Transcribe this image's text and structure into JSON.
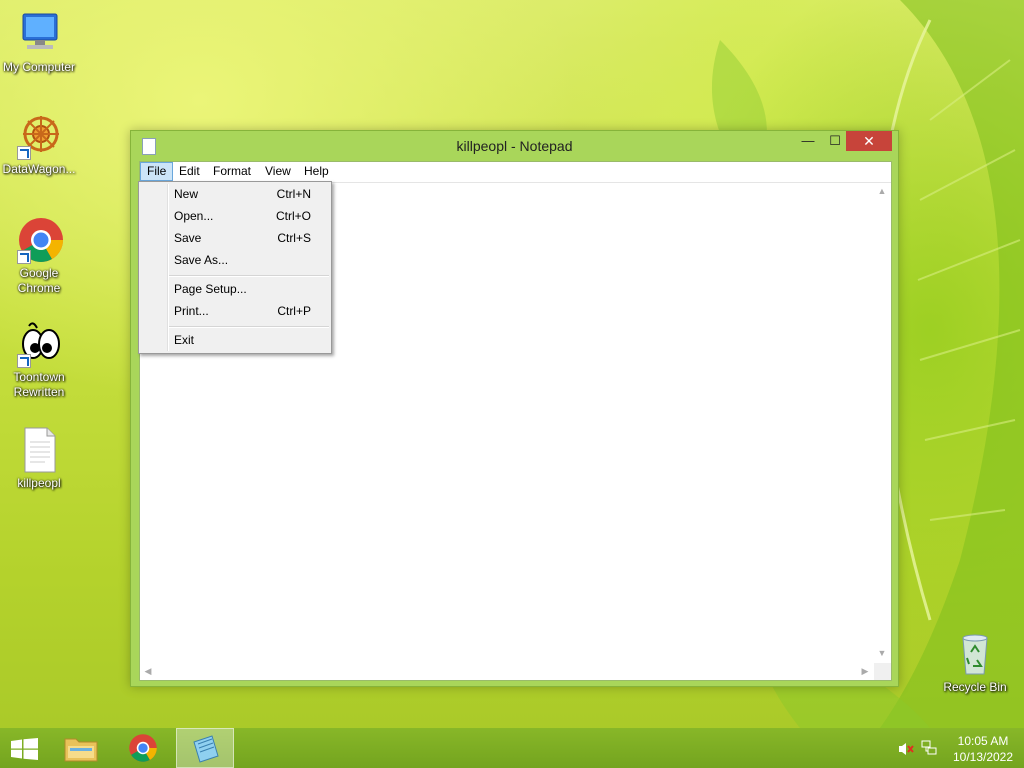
{
  "desktop": {
    "icons": [
      {
        "label": "My Computer"
      },
      {
        "label": "DataWagon..."
      },
      {
        "label": "Google Chrome"
      },
      {
        "label": "Toontown Rewritten"
      },
      {
        "label": "killpeopl"
      },
      {
        "label": "Recycle Bin"
      }
    ]
  },
  "window": {
    "title": "killpeopl - Notepad",
    "controls": {
      "minimize": "—",
      "maximize": "☐",
      "close": "✕"
    }
  },
  "menubar": {
    "items": [
      "File",
      "Edit",
      "Format",
      "View",
      "Help"
    ]
  },
  "file_menu": {
    "items": [
      {
        "label": "New",
        "shortcut": "Ctrl+N"
      },
      {
        "label": "Open...",
        "shortcut": "Ctrl+O"
      },
      {
        "label": "Save",
        "shortcut": "Ctrl+S"
      },
      {
        "label": "Save As...",
        "shortcut": ""
      },
      {
        "label": "Page Setup...",
        "shortcut": ""
      },
      {
        "label": "Print...",
        "shortcut": "Ctrl+P"
      },
      {
        "label": "Exit",
        "shortcut": ""
      }
    ]
  },
  "editor": {
    "content": ""
  },
  "taskbar": {
    "clock_time": "10:05 AM",
    "clock_date": "10/13/2022"
  }
}
